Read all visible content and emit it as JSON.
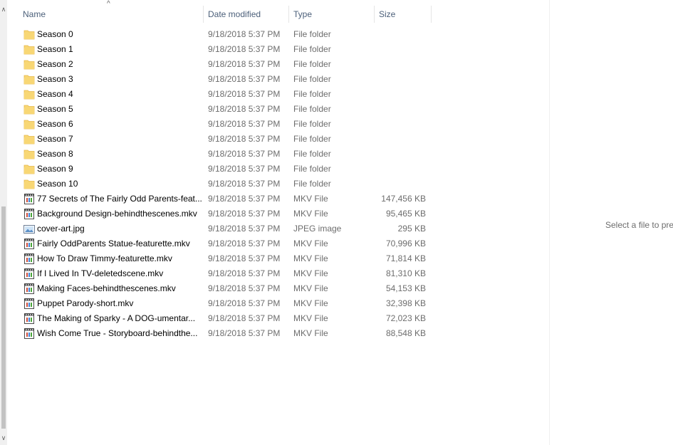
{
  "columns": {
    "name": "Name",
    "date": "Date modified",
    "type": "Type",
    "size": "Size"
  },
  "sort_indicator": "^",
  "files": [
    {
      "name": "Season 0",
      "date": "9/18/2018 5:37 PM",
      "type": "File folder",
      "size": "",
      "icon": "folder-icon"
    },
    {
      "name": "Season 1",
      "date": "9/18/2018 5:37 PM",
      "type": "File folder",
      "size": "",
      "icon": "folder-icon"
    },
    {
      "name": "Season 2",
      "date": "9/18/2018 5:37 PM",
      "type": "File folder",
      "size": "",
      "icon": "folder-icon"
    },
    {
      "name": "Season 3",
      "date": "9/18/2018 5:37 PM",
      "type": "File folder",
      "size": "",
      "icon": "folder-icon"
    },
    {
      "name": "Season 4",
      "date": "9/18/2018 5:37 PM",
      "type": "File folder",
      "size": "",
      "icon": "folder-icon"
    },
    {
      "name": "Season 5",
      "date": "9/18/2018 5:37 PM",
      "type": "File folder",
      "size": "",
      "icon": "folder-icon"
    },
    {
      "name": "Season 6",
      "date": "9/18/2018 5:37 PM",
      "type": "File folder",
      "size": "",
      "icon": "folder-icon"
    },
    {
      "name": "Season 7",
      "date": "9/18/2018 5:37 PM",
      "type": "File folder",
      "size": "",
      "icon": "folder-icon"
    },
    {
      "name": "Season 8",
      "date": "9/18/2018 5:37 PM",
      "type": "File folder",
      "size": "",
      "icon": "folder-icon"
    },
    {
      "name": "Season 9",
      "date": "9/18/2018 5:37 PM",
      "type": "File folder",
      "size": "",
      "icon": "folder-icon"
    },
    {
      "name": "Season 10",
      "date": "9/18/2018 5:37 PM",
      "type": "File folder",
      "size": "",
      "icon": "folder-icon"
    },
    {
      "name": "77 Secrets of The Fairly Odd Parents-feat...",
      "date": "9/18/2018 5:37 PM",
      "type": "MKV File",
      "size": "147,456 KB",
      "icon": "video-file-icon"
    },
    {
      "name": "Background Design-behindthescenes.mkv",
      "date": "9/18/2018 5:37 PM",
      "type": "MKV File",
      "size": "95,465 KB",
      "icon": "video-file-icon"
    },
    {
      "name": "cover-art.jpg",
      "date": "9/18/2018 5:37 PM",
      "type": "JPEG image",
      "size": "295 KB",
      "icon": "image-file-icon"
    },
    {
      "name": "Fairly OddParents Statue-featurette.mkv",
      "date": "9/18/2018 5:37 PM",
      "type": "MKV File",
      "size": "70,996 KB",
      "icon": "video-file-icon"
    },
    {
      "name": "How To Draw Timmy-featurette.mkv",
      "date": "9/18/2018 5:37 PM",
      "type": "MKV File",
      "size": "71,814 KB",
      "icon": "video-file-icon"
    },
    {
      "name": "If I Lived In TV-deletedscene.mkv",
      "date": "9/18/2018 5:37 PM",
      "type": "MKV File",
      "size": "81,310 KB",
      "icon": "video-file-icon"
    },
    {
      "name": "Making Faces-behindthescenes.mkv",
      "date": "9/18/2018 5:37 PM",
      "type": "MKV File",
      "size": "54,153 KB",
      "icon": "video-file-icon"
    },
    {
      "name": "Puppet Parody-short.mkv",
      "date": "9/18/2018 5:37 PM",
      "type": "MKV File",
      "size": "32,398 KB",
      "icon": "video-file-icon"
    },
    {
      "name": "The Making of Sparky - A DOG-umentar...",
      "date": "9/18/2018 5:37 PM",
      "type": "MKV File",
      "size": "72,023 KB",
      "icon": "video-file-icon"
    },
    {
      "name": "Wish Come True - Storyboard-behindthe...",
      "date": "9/18/2018 5:37 PM",
      "type": "MKV File",
      "size": "88,548 KB",
      "icon": "video-file-icon"
    }
  ],
  "preview": {
    "message": "Select a file to preview."
  },
  "colors": {
    "folder": "#f8d775",
    "folder_dark": "#e6b84a",
    "header_text": "#4c607a",
    "secondary_text": "#6d6d6d"
  }
}
